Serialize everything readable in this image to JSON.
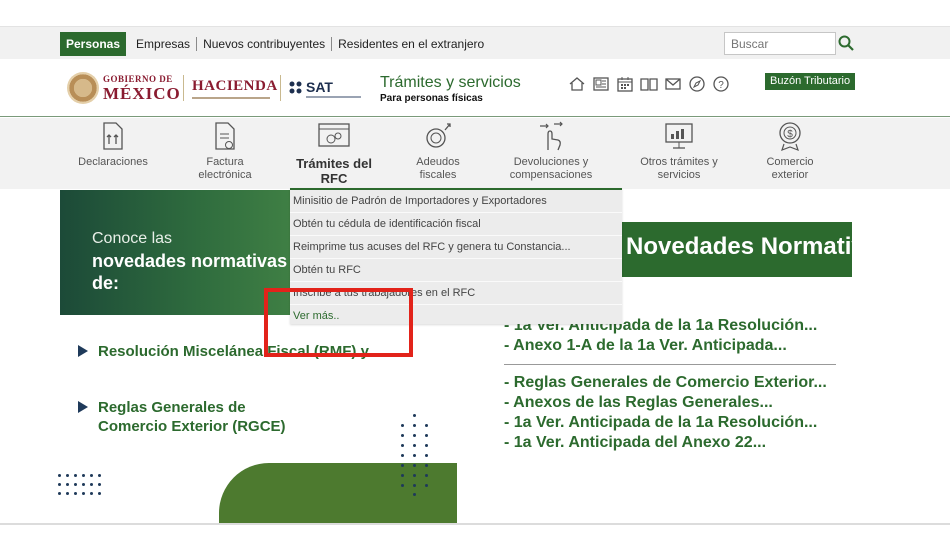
{
  "topnav": {
    "active": "Personas",
    "items": [
      "Empresas",
      "Nuevos contribuyentes",
      "Residentes en el extranjero"
    ],
    "search_placeholder": "Buscar"
  },
  "header": {
    "gobierno_small": "GOBIERNO DE",
    "gobierno_big": "MÉXICO",
    "hacienda": "HACIENDA",
    "sat": "SAT",
    "title": "Trámites y servicios",
    "subtitle": "Para personas físicas",
    "buzon": "Buzón Tributario",
    "icons": [
      "home-icon",
      "id-card-icon",
      "calendar-icon",
      "book-icon",
      "mail-icon",
      "compass-icon",
      "help-icon"
    ]
  },
  "categories": [
    {
      "label": "Declaraciones",
      "icon": "declaraciones-icon"
    },
    {
      "label": "Factura electrónica",
      "icon": "factura-icon"
    },
    {
      "label": "Trámites del RFC",
      "icon": "rfc-icon"
    },
    {
      "label": "Adeudos fiscales",
      "icon": "adeudos-icon"
    },
    {
      "label": "Devoluciones y compensaciones",
      "icon": "devoluciones-icon"
    },
    {
      "label": "Otros trámites y servicios",
      "icon": "otros-icon"
    },
    {
      "label": "Comercio exterior",
      "icon": "comercio-icon"
    }
  ],
  "dropdown": {
    "items": [
      "Minisitio de Padrón de Importadores y Exportadores",
      "Obtén tu cédula de identificación fiscal",
      "Reimprime tus acuses del RFC y genera tu Constancia...",
      "Obtén tu RFC",
      "Inscribe a tus trabajadores en el RFC"
    ],
    "more": "Ver más.."
  },
  "banner_left": {
    "line1": "Conoce las",
    "line2": "novedades normativas de:"
  },
  "left_links": [
    "Resolución Miscelánea Fiscal (RMF) y...",
    "Reglas Generales de Comercio Exterior (RGCE)"
  ],
  "banner_right": {
    "text": "Novedades Normativas"
  },
  "right_links_top": [
    "- 1a Ver. Anticipada de la 1a Resolución...",
    "- Anexo 1-A de la 1a Ver. Anticipada..."
  ],
  "right_links_bottom": [
    "- Reglas Generales de Comercio Exterior...",
    "- Anexos de las Reglas Generales...",
    "- 1a Ver. Anticipada de la 1a Resolución...",
    "- 1a Ver. Anticipada del Anexo 22..."
  ]
}
